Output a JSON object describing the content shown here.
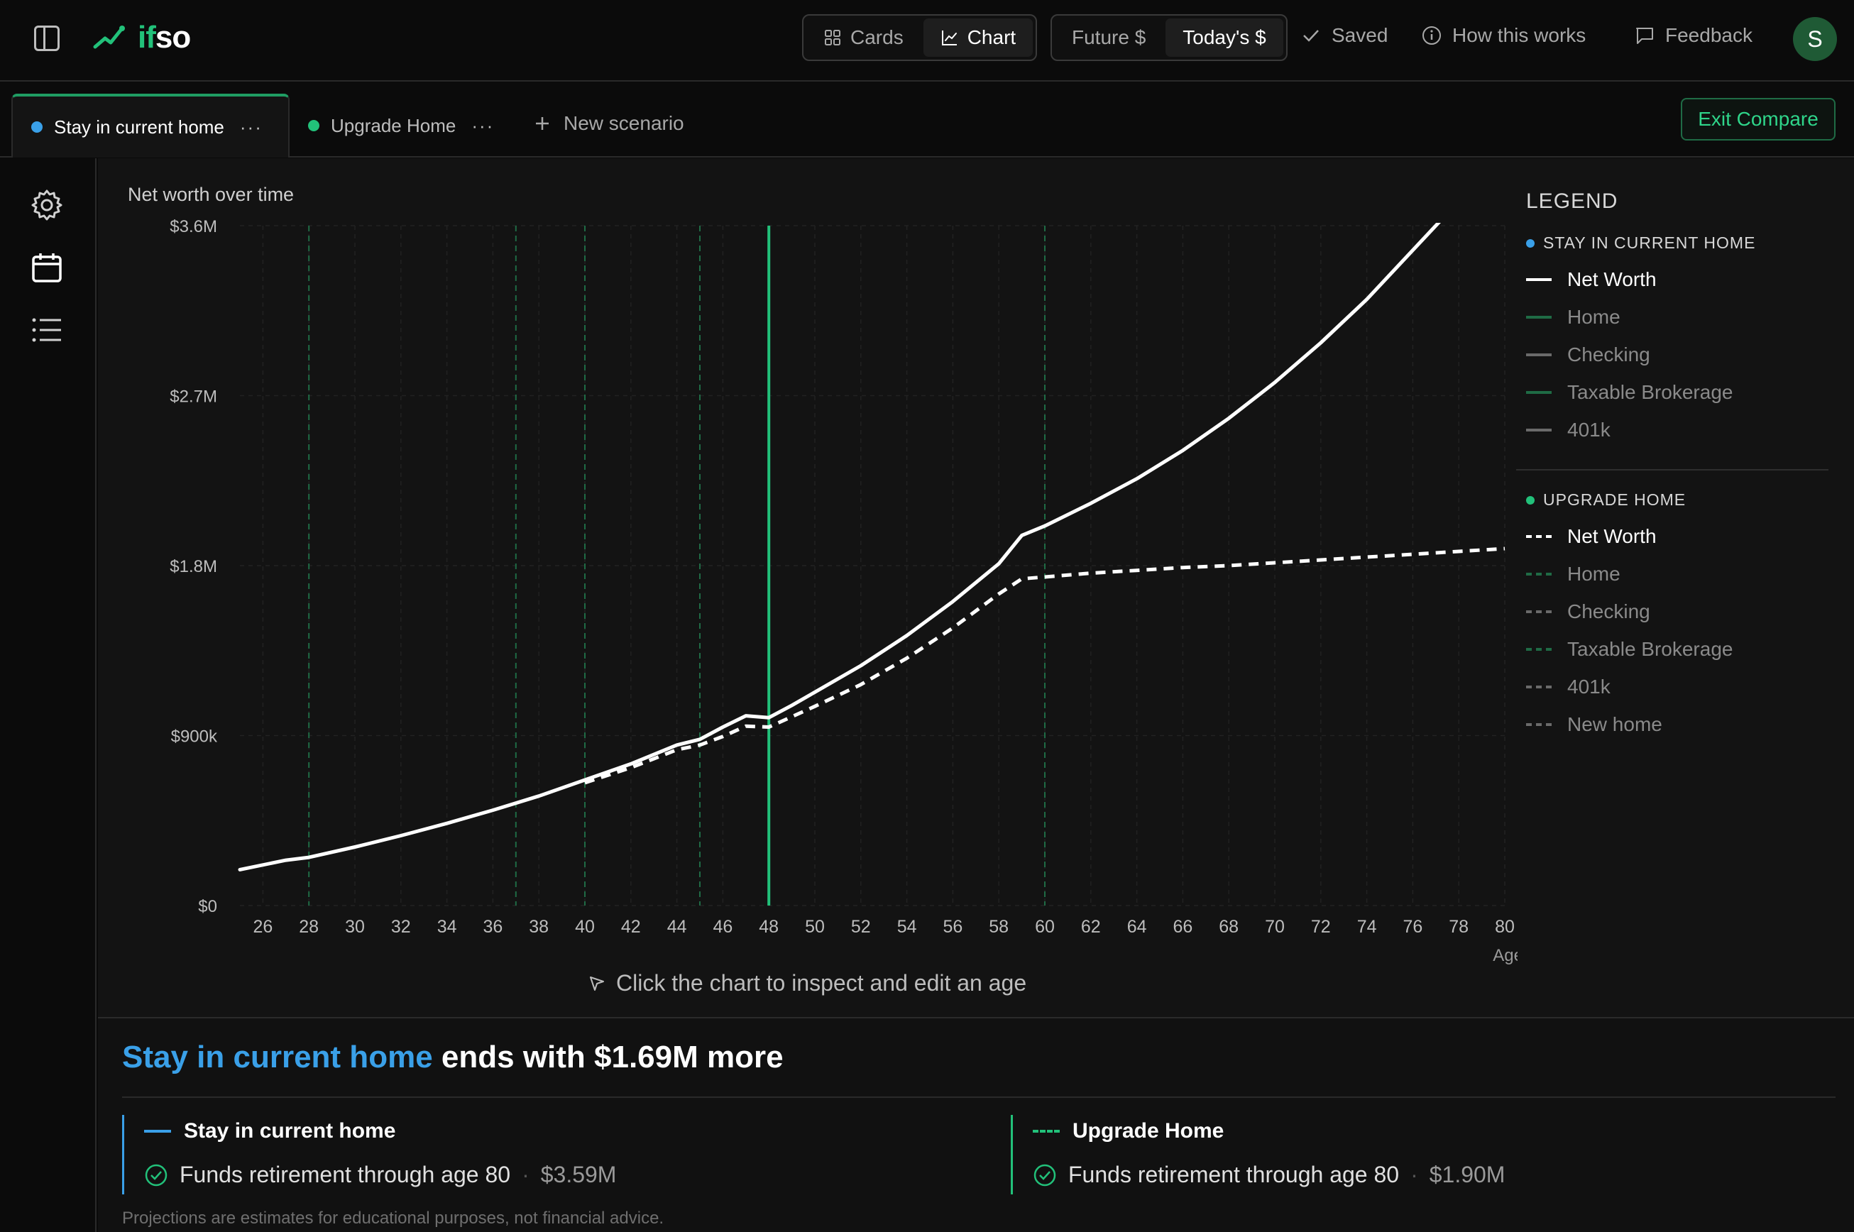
{
  "app": {
    "logo_if": "if",
    "logo_so": "so"
  },
  "view_toggle": {
    "cards": "Cards",
    "chart": "Chart",
    "active": "chart"
  },
  "dollar_toggle": {
    "future": "Future $",
    "today": "Today's $",
    "active": "today"
  },
  "header": {
    "saved": "Saved",
    "how": "How this works",
    "feedback": "Feedback",
    "avatar": "S"
  },
  "tabs": [
    {
      "label": "Stay in current home",
      "color": "#3aa0e8",
      "active": true
    },
    {
      "label": "Upgrade Home",
      "color": "#22c17a",
      "active": false
    }
  ],
  "tab_more": "···",
  "new_scenario": "New scenario",
  "exit_compare": "Exit Compare",
  "chart_data": {
    "type": "line",
    "title": "Net worth over time",
    "xlabel": "Age",
    "ylabel": "",
    "xlim": [
      25,
      80
    ],
    "ylim": [
      0,
      3600000
    ],
    "x_ticks": [
      26,
      28,
      30,
      32,
      34,
      36,
      38,
      40,
      42,
      44,
      46,
      48,
      50,
      52,
      54,
      56,
      58,
      60,
      62,
      64,
      66,
      68,
      70,
      72,
      74,
      76,
      78,
      80
    ],
    "y_ticks": [
      {
        "value": 0,
        "label": "$0"
      },
      {
        "value": 900000,
        "label": "$900k"
      },
      {
        "value": 1800000,
        "label": "$1.8M"
      },
      {
        "value": 2700000,
        "label": "$2.7M"
      },
      {
        "value": 3600000,
        "label": "$3.6M"
      }
    ],
    "event_markers": [
      28,
      37,
      40,
      45,
      60
    ],
    "selected_age": 48,
    "series": [
      {
        "name": "Stay in current home · Net Worth",
        "style": "solid",
        "x": [
          25,
          27,
          28,
          30,
          32,
          34,
          36,
          38,
          40,
          42,
          44,
          45,
          46,
          47,
          48,
          49,
          50,
          52,
          54,
          56,
          58,
          59,
          60,
          62,
          64,
          66,
          68,
          70,
          72,
          74,
          76,
          78,
          80
        ],
        "y": [
          190000,
          240000,
          255000,
          310000,
          370000,
          435000,
          505000,
          580000,
          665000,
          750000,
          850000,
          880000,
          945000,
          1005000,
          995000,
          1060000,
          1130000,
          1270000,
          1430000,
          1610000,
          1810000,
          1960000,
          2010000,
          2130000,
          2260000,
          2410000,
          2580000,
          2770000,
          2980000,
          3210000,
          3470000,
          3730000,
          4040000
        ]
      },
      {
        "name": "Upgrade Home · Net Worth",
        "style": "dashed",
        "x": [
          40,
          42,
          44,
          45,
          46,
          47,
          48,
          49,
          50,
          52,
          54,
          56,
          58,
          59,
          60,
          62,
          64,
          66,
          68,
          70,
          72,
          74,
          76,
          78,
          80
        ],
        "y": [
          650000,
          730000,
          825000,
          850000,
          895000,
          950000,
          945000,
          1000000,
          1055000,
          1170000,
          1310000,
          1470000,
          1650000,
          1730000,
          1740000,
          1760000,
          1775000,
          1790000,
          1800000,
          1815000,
          1830000,
          1845000,
          1860000,
          1875000,
          1890000
        ]
      }
    ]
  },
  "chart_hint": "Click the chart to inspect and edit an age",
  "legend": {
    "title": "LEGEND",
    "group1": {
      "label": "STAY IN CURRENT HOME",
      "items": [
        {
          "label": "Net Worth",
          "color": "#ffffff",
          "on": true
        },
        {
          "label": "Home",
          "color": "#1f6b45",
          "on": false
        },
        {
          "label": "Checking",
          "color": "#6a6a6a",
          "on": false
        },
        {
          "label": "Taxable Brokerage",
          "color": "#1f6b45",
          "on": false
        },
        {
          "label": "401k",
          "color": "#6a6a6a",
          "on": false
        }
      ]
    },
    "group2": {
      "label": "UPGRADE HOME",
      "items": [
        {
          "label": "Net Worth",
          "color": "#ffffff",
          "on": true
        },
        {
          "label": "Home",
          "color": "#1f6b45",
          "on": false
        },
        {
          "label": "Checking",
          "color": "#6a6a6a",
          "on": false
        },
        {
          "label": "Taxable Brokerage",
          "color": "#1f6b45",
          "on": false
        },
        {
          "label": "401k",
          "color": "#6a6a6a",
          "on": false
        },
        {
          "label": "New home",
          "color": "#6a6a6a",
          "on": false
        }
      ]
    }
  },
  "summary": {
    "headline_highlight": "Stay in current home",
    "headline_rest": " ends with $1.69M more",
    "cards": [
      {
        "title": "Stay in current home",
        "row": "Funds retirement through age 80",
        "value": "$3.59M",
        "accent": "#3aa0e8"
      },
      {
        "title": "Upgrade Home",
        "row": "Funds retirement through age 80",
        "value": "$1.90M",
        "accent": "#22c17a"
      }
    ],
    "dot_sep": "·",
    "footnote": "Projections are estimates for educational purposes, not financial advice."
  }
}
